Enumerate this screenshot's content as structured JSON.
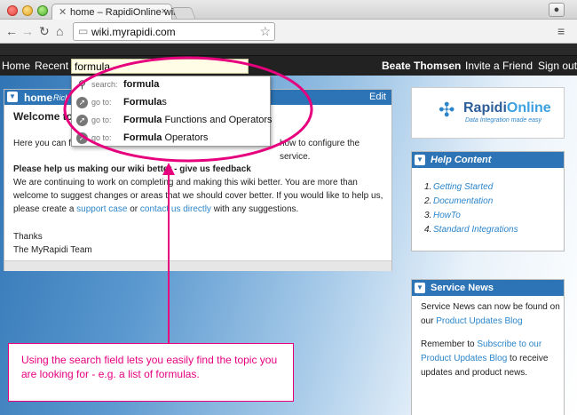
{
  "browser": {
    "tab_title": "home – RapidiOnline wiki",
    "url": "wiki.myrapidi.com"
  },
  "topnav": {
    "home": "Home",
    "recent": "Recent",
    "search_value": "formula",
    "user": "Beate Thomsen",
    "invite": "Invite a Friend",
    "signout": "Sign out"
  },
  "suggestions": [
    {
      "kind": "search:",
      "prefix": "formula",
      "bold": "",
      "suffix": ""
    },
    {
      "kind": "go to:",
      "prefix": "",
      "bold": "Formula",
      "suffix": "s"
    },
    {
      "kind": "go to:",
      "prefix": "",
      "bold": "Formula",
      "suffix": " Functions and Operators"
    },
    {
      "kind": "go to:",
      "prefix": "",
      "bold": "Formula",
      "suffix": " Operators"
    }
  ],
  "main": {
    "title": "home",
    "rich": "RichT",
    "edit": "Edit",
    "welcome": "Welcome to",
    "intro_a": "Here you can f",
    "intro_b": "how to configure the service.",
    "help_heading": "Please help us making our wiki better - give us feedback",
    "para_1": "We are continuing to work on completing and making this wiki better. You are more than welcome to suggest changes or areas that we should cover better. If you would like to help us, please create a ",
    "support_link": "support case",
    "para_or": " or ",
    "contact_link": "contact us directly",
    "para_2": " with any suggestions.",
    "thanks": "Thanks",
    "team": "The MyRapidi Team"
  },
  "logo": {
    "name_a": "Rapidi",
    "name_b": "Online",
    "tagline": "Data Integration made easy"
  },
  "help_content": {
    "title": "Help Content",
    "items": [
      {
        "num": "1.",
        "label": "Getting Started"
      },
      {
        "num": "2.",
        "label": "Documentation"
      },
      {
        "num": "3.",
        "label": "HowTo"
      },
      {
        "num": "4.",
        "label": "Standard Integrations"
      }
    ]
  },
  "service_news": {
    "title": "Service News",
    "line_1": "Service News can now be found on our ",
    "link_1": "Product Updates Blog",
    "line_2": "Remember to ",
    "link_2": "Subscribe to our Product Updates Blog",
    "line_3": " to receive updates and product news."
  },
  "callout": {
    "text": "Using the search field lets you easily find the topic you are looking for - e.g. a list of formulas."
  },
  "colors": {
    "accent": "#2c74b6",
    "annotation": "#e6007e",
    "link": "#2c85c9"
  }
}
